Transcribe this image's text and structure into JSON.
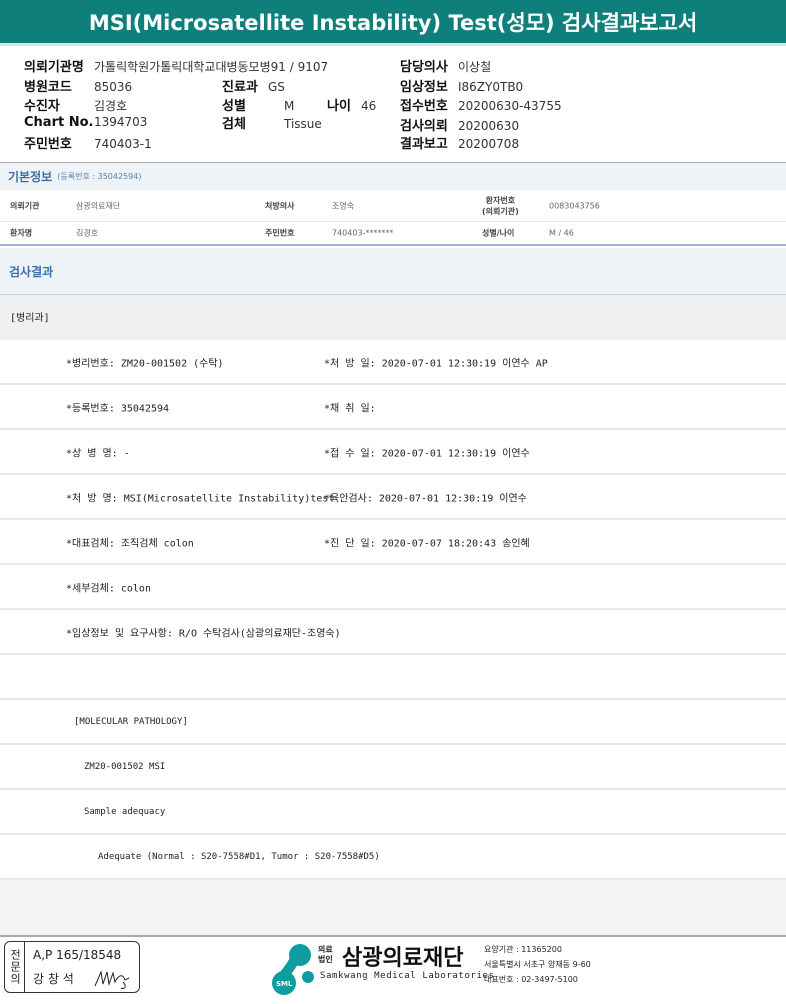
{
  "title": "MSI(Microsatellite Instability) Test(성모) 검사결과보고서",
  "header": {
    "institution_label": "의뢰기관명",
    "institution": "가톨릭학원가톨릭대학교대병동모병91 / 9107",
    "hospital_code_label": "병원코드",
    "hospital_code": "85036",
    "patient_label": "수진자",
    "patient": "김경호",
    "chart_label": "Chart No.",
    "chart": "1394703",
    "rrn_label": "주민번호",
    "rrn": "740403-1",
    "dept_label": "진료과",
    "dept": "GS",
    "sex_label": "성별",
    "sex": "M",
    "age_label": "나이",
    "age": "46",
    "specimen_label": "검체",
    "specimen": "Tissue",
    "doctor_label": "담당의사",
    "doctor": "이상철",
    "clinical_label": "임상정보",
    "clinical": "I86ZY0TB0",
    "receipt_label": "접수번호",
    "receipt": "20200630-43755",
    "request_label": "검사의뢰",
    "request": "20200630",
    "report_label": "결과보고",
    "report": "20200708"
  },
  "basic": {
    "title": "기본정보",
    "reg": "(등록번호 : 35042594)",
    "inst_label": "의뢰기관",
    "inst": "삼광의료재단",
    "presc_label": "처방의사",
    "presc": "조영숙",
    "pno_label1": "환자번호",
    "pno_label2": "(의뢰기관)",
    "pno": "0083043756",
    "name_label": "환자명",
    "name": "김경호",
    "rrn_label": "주민번호",
    "rrn": "740403-*******",
    "sexage_label": "성별/나이",
    "sexage": "M / 46"
  },
  "results": {
    "title": "검사결과",
    "dept": "[병리과]",
    "rows": [
      {
        "left": "*병리번호: ZM20-001502 (수탁)",
        "right": "*처 방 일: 2020-07-01 12:30:19  이연수 AP"
      },
      {
        "left": "*등록번호: 35042594",
        "right": "*채 취 일:"
      },
      {
        "left": "*상 병 명: -",
        "right": "*접 수 일: 2020-07-01 12:30:19  이연수"
      },
      {
        "left": "*처 방 명: MSI(Microsatellite Instability)test",
        "right": "*육안검사: 2020-07-01 12:30:19  이연수"
      },
      {
        "left": "*대표검체: 조직검체 colon",
        "right": "*진 단 일: 2020-07-07 18:20:43  송인혜"
      },
      {
        "left": "*세부검체: colon",
        "right": ""
      },
      {
        "left": "*임상정보 및 요구사항: R/O 수탁검사(삼광의료재단-조영숙)",
        "right": ""
      },
      {
        "left": "",
        "right": ""
      }
    ],
    "mp": [
      "[MOLECULAR PATHOLOGY]",
      "ZM20-001502     MSI",
      "Sample adequacy",
      "Adequate (Normal : S20-7558#D1, Tumor : S20-7558#D5)"
    ]
  },
  "footer": {
    "specialist": "전문의",
    "ap": "A,P 165/18548",
    "name": "강 창 석",
    "org_small1": "의료",
    "org_small2": "법인",
    "org": "삼광의료재단",
    "org_en": "Samkwang Medical Laboratories",
    "logo": "SML",
    "code": "요양기관 : 11365200",
    "addr": "서울특별시 서초구 양재동 9-60",
    "phone": "대표번호 : 02-3497-5100",
    "teal": "#0e7f7b"
  }
}
